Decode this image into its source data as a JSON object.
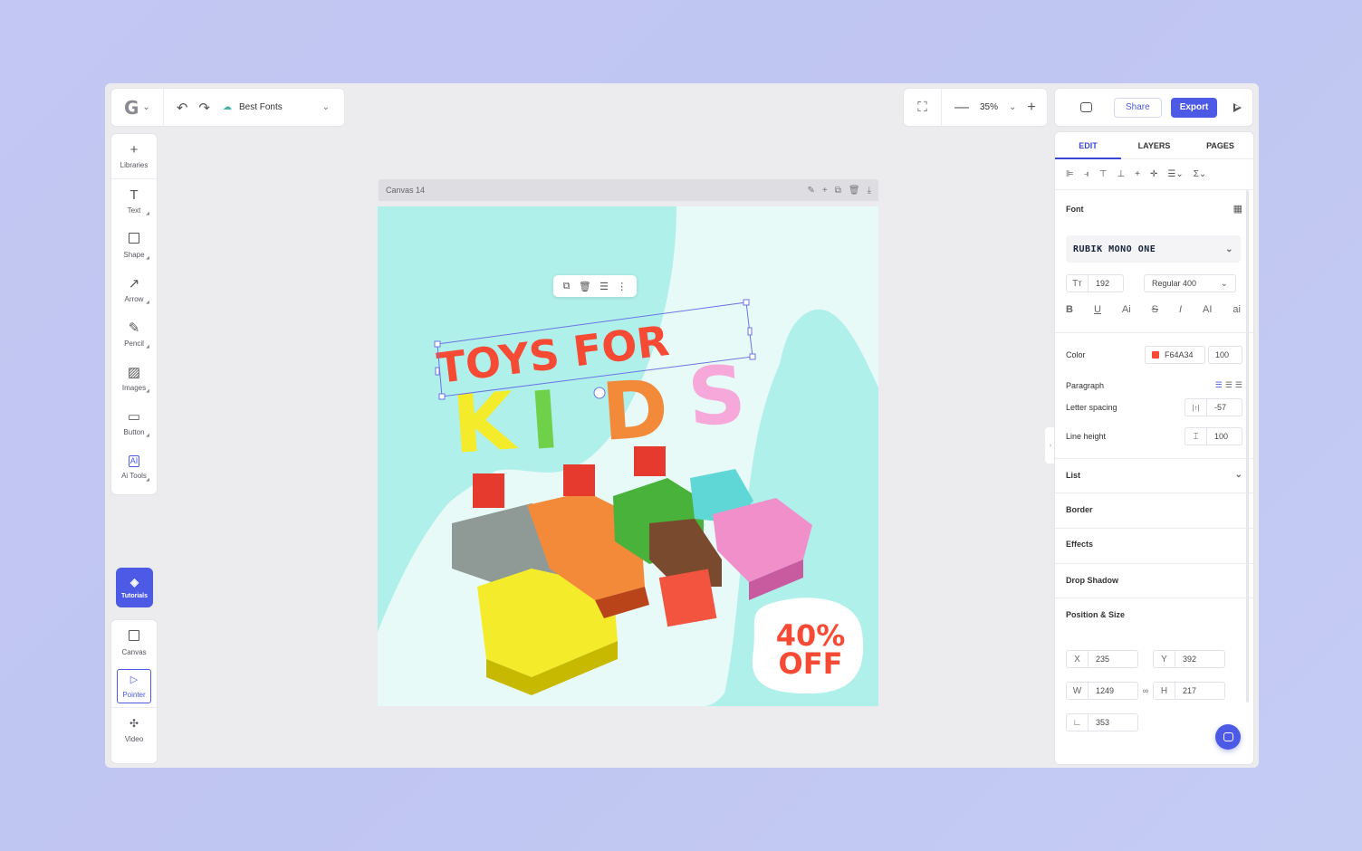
{
  "header": {
    "logo": "G",
    "doc_name": "Best Fonts",
    "zoom": "35%",
    "share_label": "Share",
    "export_label": "Export"
  },
  "tools": [
    {
      "label": "Libraries",
      "icon": "plus-icon"
    },
    {
      "label": "Text",
      "icon": "text-icon"
    },
    {
      "label": "Shape",
      "icon": "square-icon"
    },
    {
      "label": "Arrow",
      "icon": "arrow-icon"
    },
    {
      "label": "Pencil",
      "icon": "pencil-icon"
    },
    {
      "label": "Images",
      "icon": "image-icon"
    },
    {
      "label": "Button",
      "icon": "button-icon"
    },
    {
      "label": "Ai Tools",
      "icon": "ai-icon"
    }
  ],
  "tutorials_label": "Tutorials",
  "bottom_tools": [
    {
      "label": "Canvas",
      "icon": "canvas-icon"
    },
    {
      "label": "Pointer",
      "icon": "pointer-icon"
    },
    {
      "label": "Video",
      "icon": "video-icon"
    }
  ],
  "canvas": {
    "name": "Canvas 14",
    "headline_1": "TOYS FOR",
    "headline_2": "KIDS",
    "badge_line_1": "40%",
    "badge_line_2": "OFF"
  },
  "panel": {
    "tabs": [
      "EDIT",
      "LAYERS",
      "PAGES"
    ],
    "font_label": "Font",
    "font_name": "RUBIK MONO ONE",
    "font_size": "192",
    "font_weight": "Regular 400",
    "format": [
      "B",
      "U",
      "Ai",
      "S",
      "I",
      "AI",
      "ai"
    ],
    "color_label": "Color",
    "color_hex": "F64A34",
    "color_opacity": "100",
    "paragraph_label": "Paragraph",
    "letter_spacing_label": "Letter spacing",
    "letter_spacing": "-57",
    "line_height_label": "Line height",
    "line_height": "100",
    "sections": [
      "List",
      "Border",
      "Effects",
      "Drop Shadow",
      "Position & Size"
    ],
    "x": "235",
    "y": "392",
    "w": "1249",
    "h": "217",
    "rotation": "353",
    "x_label": "X",
    "y_label": "Y",
    "w_label": "W",
    "h_label": "H"
  },
  "colors": {
    "accent": "#4c5ae6",
    "headline_red": "#F64A34",
    "teal_bg": "#aff0ea"
  }
}
